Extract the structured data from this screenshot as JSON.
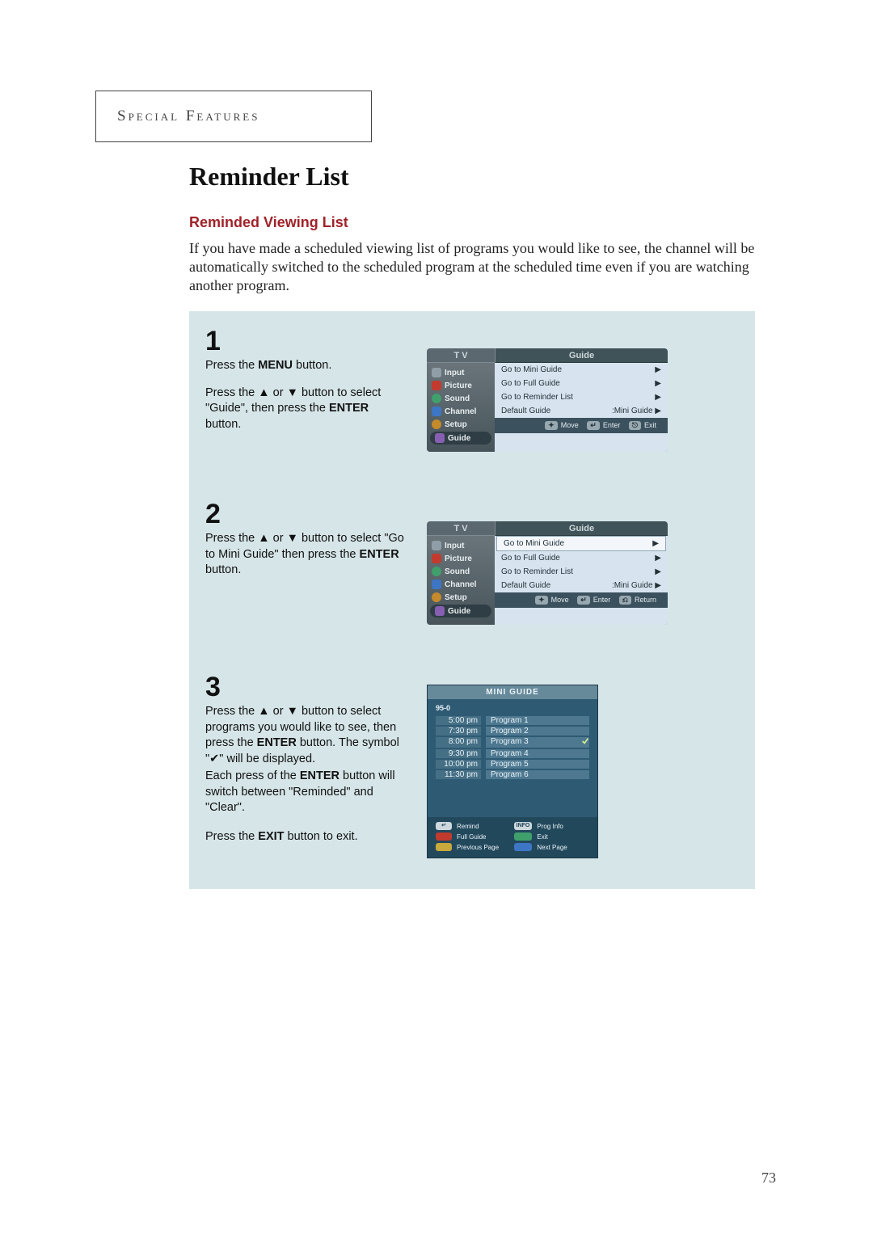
{
  "section_label": "Special Features",
  "title": "Reminder List",
  "subhead": "Reminded Viewing List",
  "intro": "If you have made a scheduled viewing list of programs you would like to see, the channel will be automatically switched to the scheduled program at the scheduled time even if you are watching another program.",
  "page_number": "73",
  "steps": {
    "s1": {
      "num": "1",
      "p1a": "Press the ",
      "p1b": "MENU",
      "p1c": " button.",
      "p2a": "Press the ▲ or ▼ button to select \"Guide\", then press the ",
      "p2b": "ENTER",
      "p2c": " button."
    },
    "s2": {
      "num": "2",
      "p1a": "Press the ▲ or ▼ button to select \"Go to Mini Guide\" then press the ",
      "p1b": "ENTER",
      "p1c": " button."
    },
    "s3": {
      "num": "3",
      "text_lines": [
        "Press the ▲ or ▼ button to select programs you would like to see, then press the ENTER button. The symbol \"✔\" will be displayed.",
        "Each press of the ENTER button will switch between \"Reminded\" and \"Clear\".",
        "Press the EXIT button to exit."
      ],
      "p1a": "Press the ▲ or ▼ button to select programs you would like to see, then press the ",
      "p1b": "ENTER",
      "p1c": " button. The symbol \"✔\" will be displayed.",
      "p2a": "Each press of the ",
      "p2b": "ENTER",
      "p2c": " button will switch between \"Reminded\" and \"Clear\".",
      "p3a": "Press the ",
      "p3b": "EXIT",
      "p3c": " button to exit."
    }
  },
  "osd": {
    "header_left": "T V",
    "header_right": "Guide",
    "side_items": [
      "Input",
      "Picture",
      "Sound",
      "Channel",
      "Setup",
      "Guide"
    ],
    "rows": [
      {
        "label": "Go to Mini Guide",
        "value": "▶"
      },
      {
        "label": "Go to Full Guide",
        "value": "▶"
      },
      {
        "label": "Go to Reminder List",
        "value": "▶"
      },
      {
        "label": "Default Guide",
        "value": ":Mini Guide ▶"
      }
    ],
    "footer1": {
      "move": "Move",
      "enter": "Enter",
      "exit": "Exit"
    },
    "footer2": {
      "move": "Move",
      "enter": "Enter",
      "exit": "Return"
    }
  },
  "mini": {
    "title": "MINI GUIDE",
    "channel": "95-0",
    "rows": [
      {
        "time": "5:00 pm",
        "prog": "Program 1",
        "checked": false
      },
      {
        "time": "7:30 pm",
        "prog": "Program 2",
        "checked": false
      },
      {
        "time": "8:00 pm",
        "prog": "Program 3",
        "checked": true
      },
      {
        "time": "9:30 pm",
        "prog": "Program 4",
        "checked": false
      },
      {
        "time": "10:00 pm",
        "prog": "Program 5",
        "checked": false
      },
      {
        "time": "11:30 pm",
        "prog": "Program 6",
        "checked": false
      }
    ],
    "legend": {
      "remind_key": "↵",
      "remind": "Remind",
      "info_key": "INFO",
      "info": "Prog Info",
      "full": "Full Guide",
      "exit": "Exit",
      "prev": "Previous Page",
      "next": "Next Page"
    }
  }
}
